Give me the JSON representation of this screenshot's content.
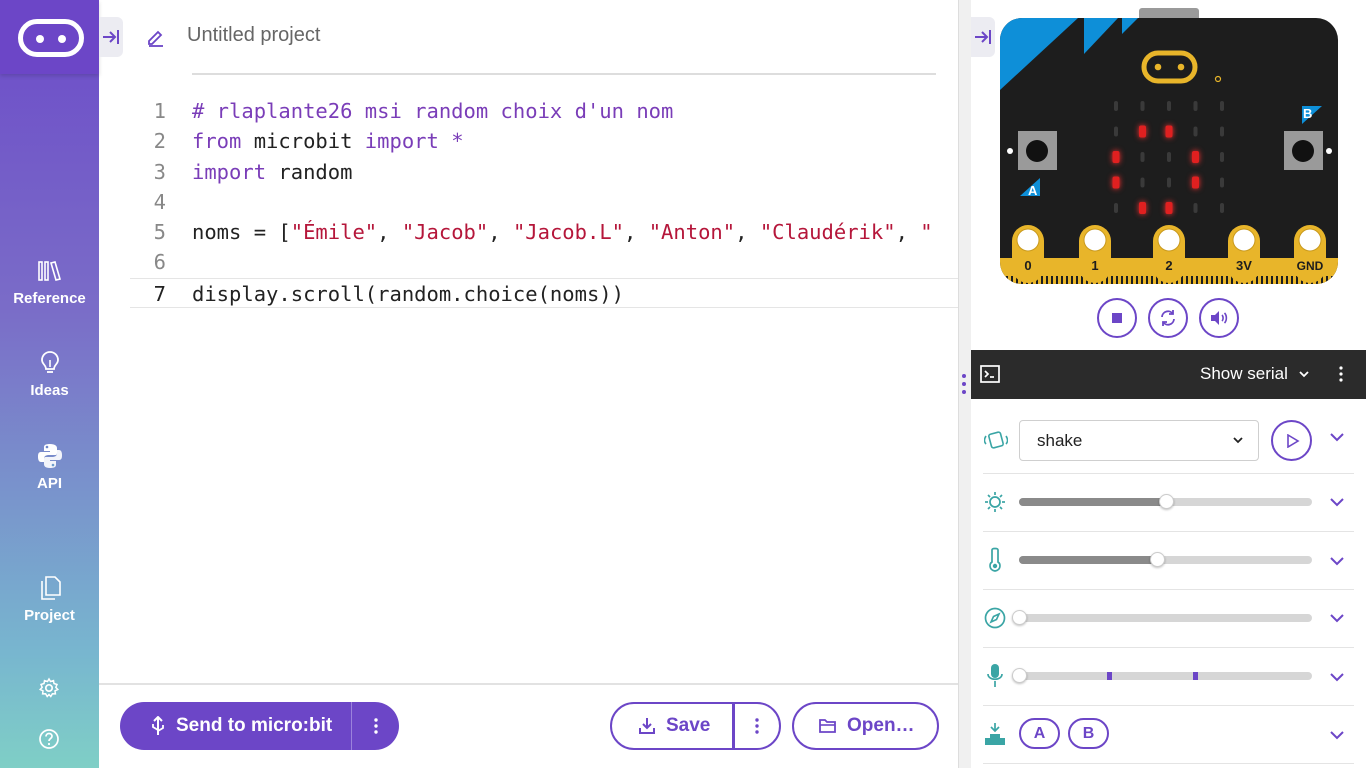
{
  "sidebar": {
    "items": [
      {
        "label": "Reference",
        "icon": "library-icon"
      },
      {
        "label": "Ideas",
        "icon": "lightbulb-icon"
      },
      {
        "label": "API",
        "icon": "python-icon"
      },
      {
        "label": "Project",
        "icon": "files-icon"
      }
    ]
  },
  "editor": {
    "project_name": "Untitled project",
    "lines": [
      {
        "n": "1",
        "html": "<span class='c-comment'># rlaplante26 msi random choix d'un nom</span>"
      },
      {
        "n": "2",
        "html": "<span class='c-kw'>from</span> microbit <span class='c-kw'>import</span> <span class='c-kw'>*</span>"
      },
      {
        "n": "3",
        "html": "<span class='c-kw'>import</span> random"
      },
      {
        "n": "4",
        "html": ""
      },
      {
        "n": "5",
        "html": "noms = [<span class='c-str'>\"Émile\"</span>, <span class='c-str'>\"Jacob\"</span>, <span class='c-str'>\"Jacob.L\"</span>, <span class='c-str'>\"Anton\"</span>, <span class='c-str'>\"Claudérik\"</span>, <span class='c-str'>\"</span>"
      },
      {
        "n": "6",
        "html": ""
      },
      {
        "n": "7",
        "html": "display.scroll(random.choice(noms))"
      }
    ],
    "active_line": "7"
  },
  "toolbar": {
    "send_label": "Send to micro:bit",
    "save_label": "Save",
    "open_label": "Open…"
  },
  "simulator": {
    "pins": [
      "0",
      "1",
      "2",
      "3V",
      "GND"
    ],
    "button_a": "A",
    "button_b": "B",
    "leds": [
      [
        0,
        0,
        0,
        0,
        0
      ],
      [
        0,
        1,
        1,
        0,
        0
      ],
      [
        1,
        0,
        0,
        1,
        0
      ],
      [
        1,
        0,
        0,
        1,
        0
      ],
      [
        0,
        1,
        1,
        0,
        0
      ]
    ],
    "serial_label": "Show serial",
    "gesture_value": "shake",
    "light_level": 0.5,
    "temperature_level": 0.47,
    "compass_level": 0.0,
    "sound_level": 0.0,
    "ab_buttons": [
      "A",
      "B"
    ]
  },
  "colors": {
    "accent": "#6c46c7",
    "led_on": "#e02020",
    "board": "#1d1d1d",
    "gold": "#e8b52a",
    "corner": "#0e8fd8"
  }
}
